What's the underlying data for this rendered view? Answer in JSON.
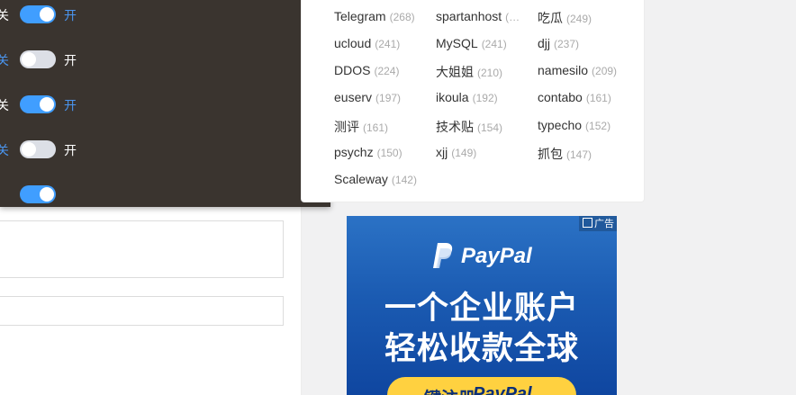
{
  "switch_panel": {
    "rows": [
      {
        "off_label": "关",
        "on_label": "开",
        "state": "on"
      },
      {
        "off_label": "关",
        "on_label": "开",
        "state": "off"
      },
      {
        "off_label": "关",
        "on_label": "开",
        "state": "on"
      },
      {
        "off_label": "关",
        "on_label": "开",
        "state": "off"
      },
      {
        "off_label": "",
        "on_label": "",
        "state": "on"
      }
    ]
  },
  "tag_cloud": {
    "tags": [
      {
        "name": "Telegram",
        "count": "(268)"
      },
      {
        "name": "spartanhost",
        "count": "(…"
      },
      {
        "name": "吃瓜",
        "count": "(249)"
      },
      {
        "name": "ucloud",
        "count": "(241)"
      },
      {
        "name": "MySQL",
        "count": "(241)"
      },
      {
        "name": "djj",
        "count": "(237)"
      },
      {
        "name": "DDOS",
        "count": "(224)"
      },
      {
        "name": "大姐姐",
        "count": "(210)"
      },
      {
        "name": "namesilo",
        "count": "(209)"
      },
      {
        "name": "euserv",
        "count": "(197)"
      },
      {
        "name": "ikoula",
        "count": "(192)"
      },
      {
        "name": "contabo",
        "count": "(161)"
      },
      {
        "name": "测评",
        "count": "(161)"
      },
      {
        "name": "技术贴",
        "count": "(154)"
      },
      {
        "name": "typecho",
        "count": "(152)"
      },
      {
        "name": "psychz",
        "count": "(150)"
      },
      {
        "name": "xjj",
        "count": "(149)"
      },
      {
        "name": "抓包",
        "count": "(147)"
      },
      {
        "name": "Scaleway",
        "count": "(142)"
      }
    ]
  },
  "ad": {
    "badge": "广告",
    "brand": "PayPal",
    "headline_1": "一个企业账户",
    "headline_2": "轻松收款全球",
    "cta_text": "一键注册",
    "cta_brand": "PayPal"
  },
  "colors": {
    "panel_bg": "#3a342f",
    "switch_on": "#409eff",
    "switch_off": "#dcdfe6",
    "active_label": "#4a95ef",
    "ad_blue": "#1b5bb2",
    "cta_yellow": "#ffd140"
  }
}
